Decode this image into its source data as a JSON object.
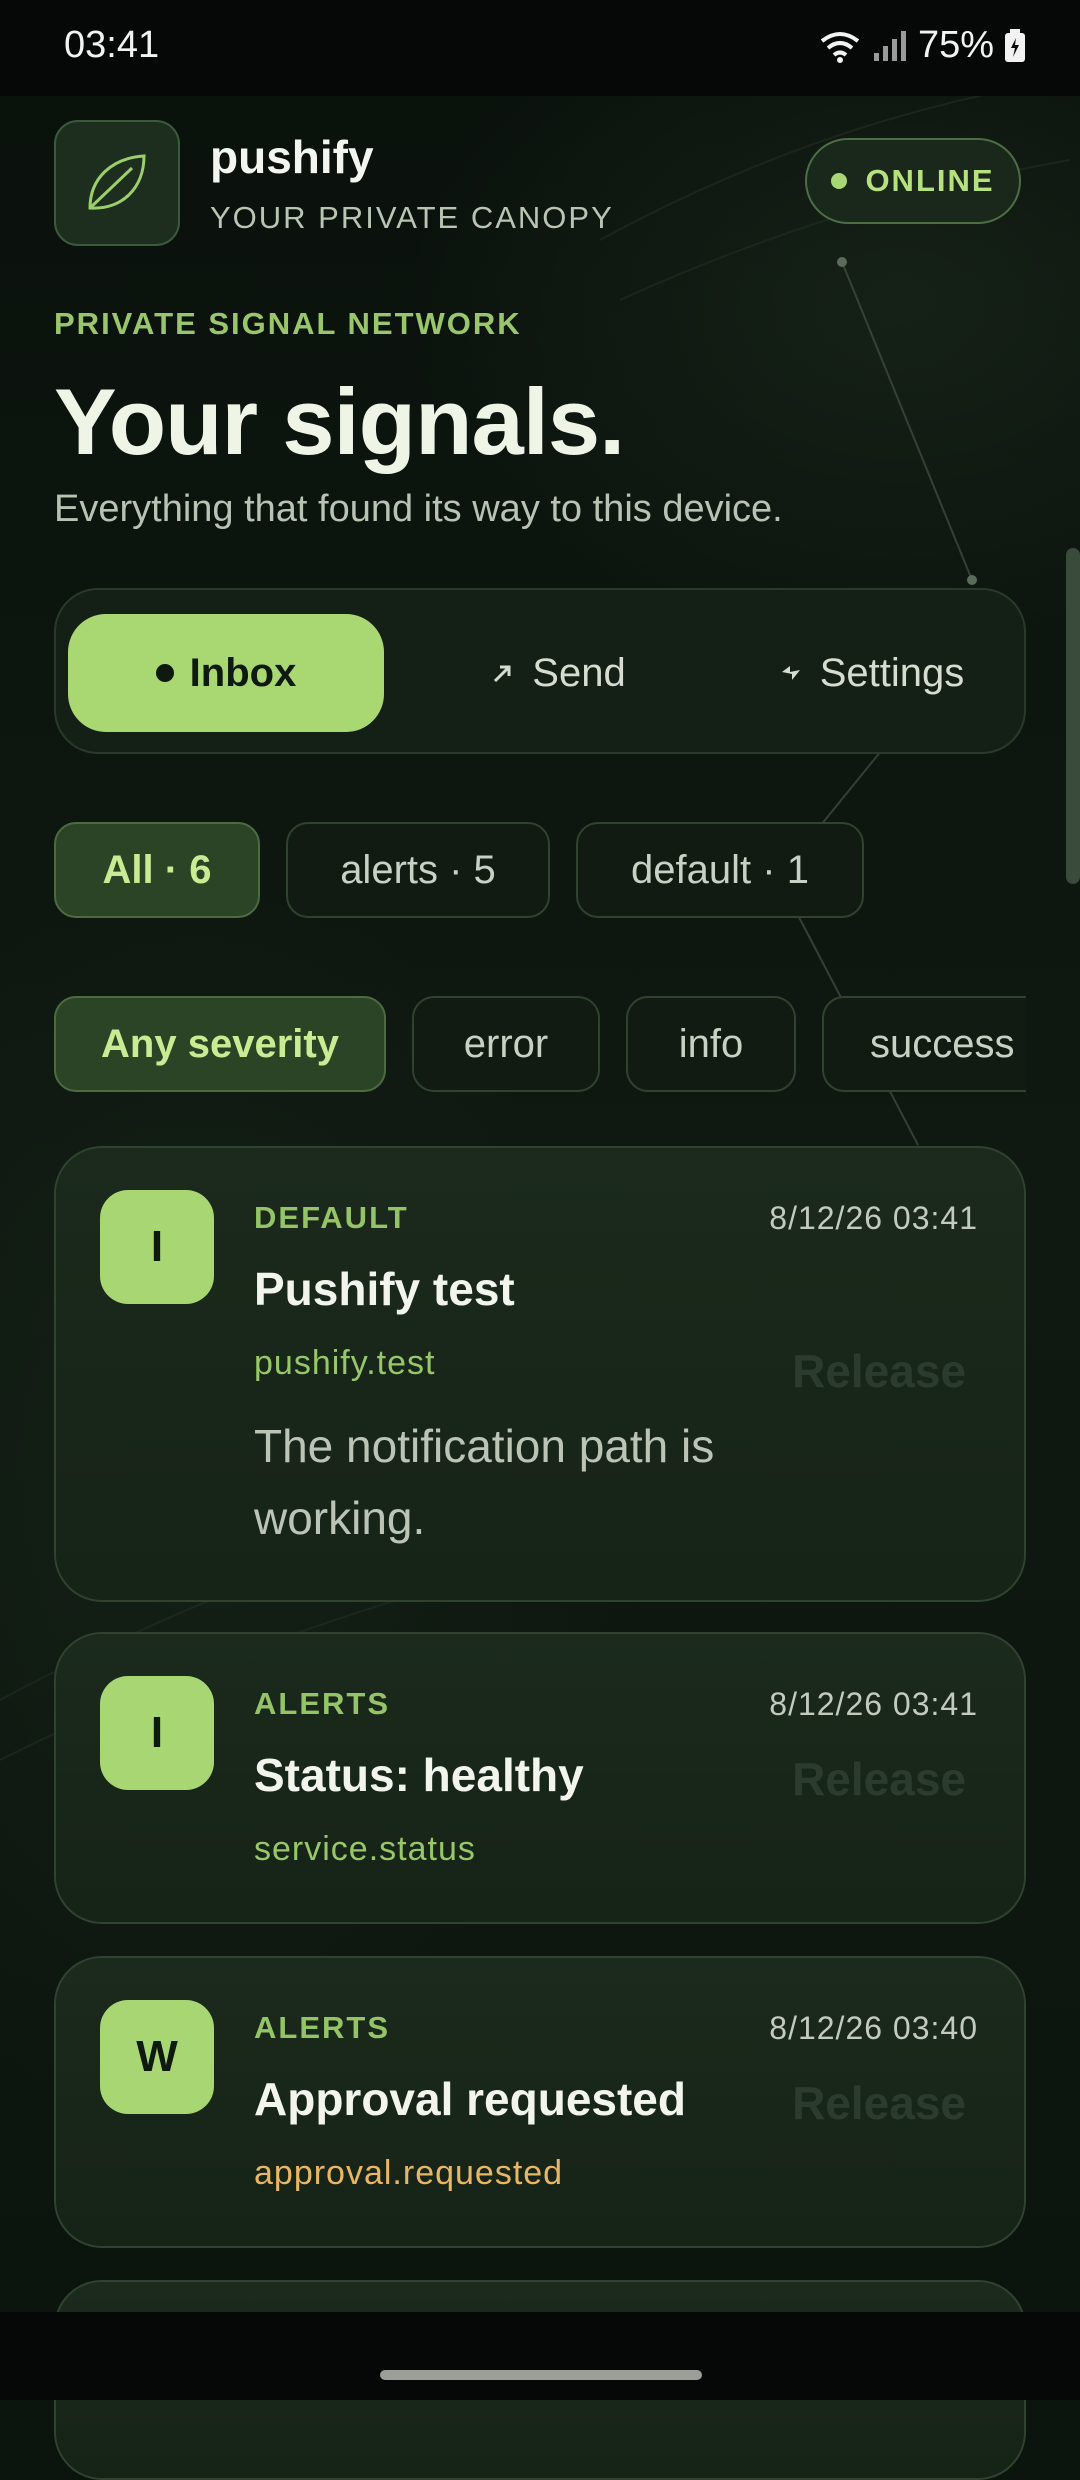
{
  "status_bar": {
    "time": "03:41",
    "battery": "75%"
  },
  "header": {
    "brand": "pushify",
    "tagline": "YOUR PRIVATE CANOPY",
    "status": "ONLINE"
  },
  "hero": {
    "eyebrow": "PRIVATE SIGNAL NETWORK",
    "title": "Your signals.",
    "subtitle": "Everything that found its way to this device."
  },
  "nav": {
    "tabs": [
      {
        "label": "Inbox",
        "icon": "dot-icon",
        "active": true
      },
      {
        "label": "Send",
        "icon": "arrow-up-right-icon",
        "active": false
      },
      {
        "label": "Settings",
        "icon": "bolt-icon",
        "active": false
      }
    ]
  },
  "channel_filters": [
    {
      "label": "All · 6",
      "active": true
    },
    {
      "label": "alerts · 5",
      "active": false
    },
    {
      "label": "default · 1",
      "active": false
    }
  ],
  "severity_filters": [
    {
      "label": "Any severity",
      "active": true
    },
    {
      "label": "error",
      "active": false
    },
    {
      "label": "info",
      "active": false
    },
    {
      "label": "success",
      "active": false
    }
  ],
  "notifications": [
    {
      "avatar": "I",
      "category": "DEFAULT",
      "time": "8/12/26 03:41",
      "title": "Pushify test",
      "source": "pushify.test",
      "source_color": "#97c768",
      "body": "The notification path is working.",
      "action": "Release"
    },
    {
      "avatar": "I",
      "category": "ALERTS",
      "time": "8/12/26 03:41",
      "title": "Status: healthy",
      "source": "service.status",
      "source_color": "#97c768",
      "body": "",
      "action": "Release"
    },
    {
      "avatar": "W",
      "category": "ALERTS",
      "time": "8/12/26 03:40",
      "title": "Approval requested",
      "source": "approval.requested",
      "source_color": "#e9b764",
      "body": "",
      "action": "Release"
    }
  ],
  "colors": {
    "accent": "#a9d873",
    "background": "#0c140e",
    "card": "#182619",
    "warning": "#e9b764"
  }
}
